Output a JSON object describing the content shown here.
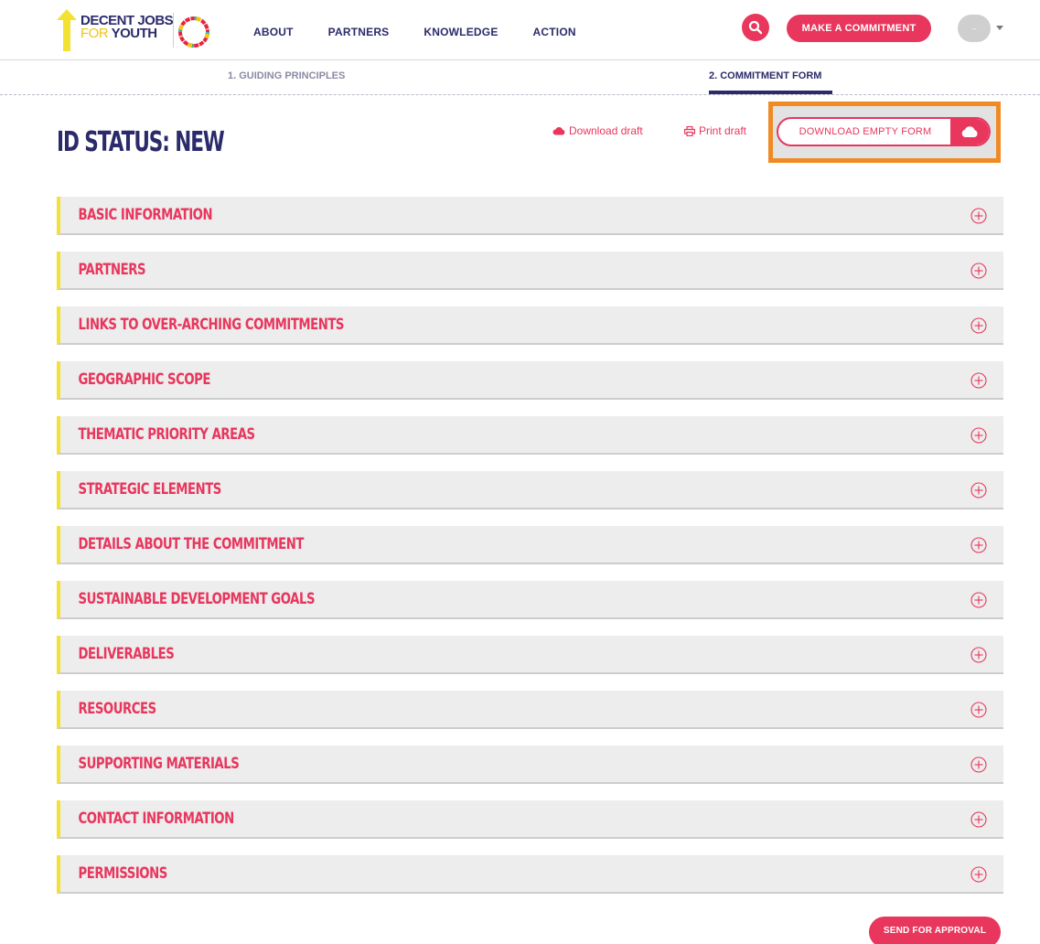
{
  "brand": {
    "logo_line1": "DECENT JOBS",
    "logo_line2_prefix": "FOR",
    "logo_line2_main": "YOUTH",
    "accent_color": "#e8365d",
    "navy_color": "#2b2b6b",
    "yellow_color": "#f3e234"
  },
  "nav": {
    "items": [
      "ABOUT",
      "PARTNERS",
      "KNOWLEDGE",
      "ACTION"
    ],
    "make_commitment": "MAKE A COMMITMENT",
    "avatar_text": "--"
  },
  "steps": {
    "step1": "1. GUIDING PRINCIPLES",
    "step2": "2. COMMITMENT FORM",
    "active": 2
  },
  "status": {
    "title": "ID STATUS: NEW",
    "download_draft": "Download draft",
    "print_draft": "Print draft",
    "download_empty_form": "DOWNLOAD EMPTY FORM"
  },
  "sections": [
    "BASIC INFORMATION",
    "PARTNERS",
    "LINKS TO OVER-ARCHING COMMITMENTS",
    "GEOGRAPHIC SCOPE",
    "THEMATIC PRIORITY AREAS",
    "STRATEGIC ELEMENTS",
    "DETAILS ABOUT THE COMMITMENT",
    "SUSTAINABLE DEVELOPMENT GOALS",
    "DELIVERABLES",
    "RESOURCES",
    "SUPPORTING MATERIALS",
    "CONTACT INFORMATION",
    "PERMISSIONS"
  ],
  "footer": {
    "send_for_approval": "SEND FOR APPROVAL"
  }
}
